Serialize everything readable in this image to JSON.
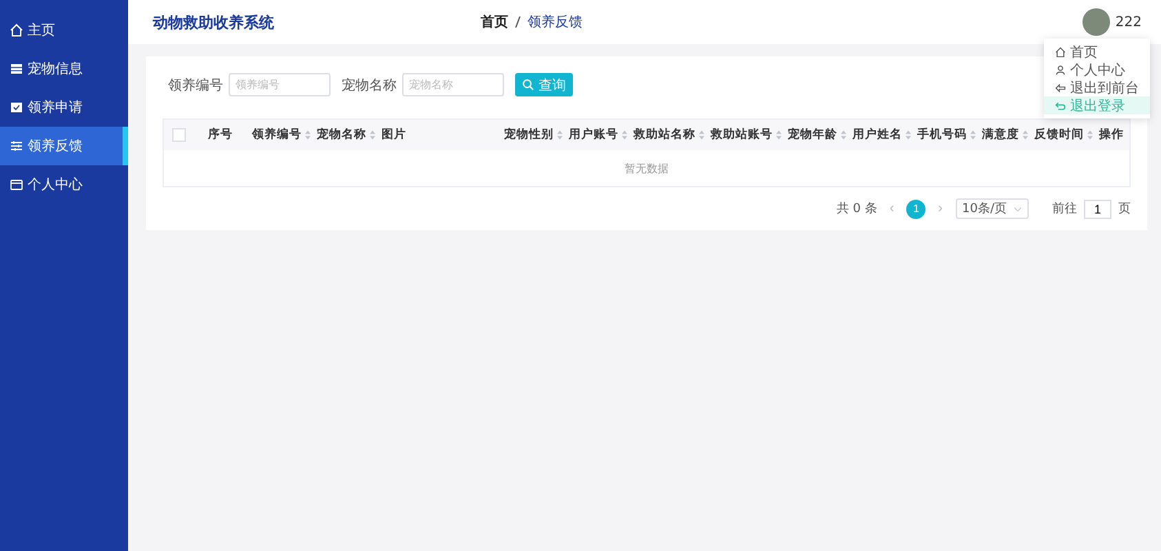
{
  "sidebar": {
    "items": [
      {
        "label": "主页",
        "kind": "home",
        "selected": false
      },
      {
        "label": "宠物信息",
        "kind": "table",
        "selected": false
      },
      {
        "label": "领养申请",
        "kind": "check",
        "selected": false
      },
      {
        "label": "领养反馈",
        "kind": "sliders",
        "selected": true
      },
      {
        "label": "个人中心",
        "kind": "card",
        "selected": false
      }
    ]
  },
  "header": {
    "title": "动物救助收养系统",
    "breadcrumb": [
      "首页",
      "领养反馈"
    ],
    "username": "222"
  },
  "user_menu": {
    "items": [
      {
        "label": "首页",
        "kind": "home",
        "selected": false
      },
      {
        "label": "个人中心",
        "kind": "user",
        "selected": false
      },
      {
        "label": "退出到前台",
        "kind": "arrow",
        "selected": false
      },
      {
        "label": "退出登录",
        "kind": "return",
        "selected": true
      }
    ]
  },
  "search": {
    "fields": [
      {
        "label": "领养编号",
        "placeholder": "领养编号"
      },
      {
        "label": "宠物名称",
        "placeholder": "宠物名称"
      }
    ],
    "button": "查询"
  },
  "table": {
    "columns": [
      {
        "label": "序号",
        "sortable": false
      },
      {
        "label": "领养编号",
        "sortable": true
      },
      {
        "label": "宠物名称",
        "sortable": true
      },
      {
        "label": "图片",
        "sortable": false
      },
      {
        "label": "宠物性别",
        "sortable": true
      },
      {
        "label": "用户账号",
        "sortable": true
      },
      {
        "label": "救助站名称",
        "sortable": true
      },
      {
        "label": "救助站账号",
        "sortable": true
      },
      {
        "label": "宠物年龄",
        "sortable": true
      },
      {
        "label": "用户姓名",
        "sortable": true
      },
      {
        "label": "手机号码",
        "sortable": true
      },
      {
        "label": "满意度",
        "sortable": true
      },
      {
        "label": "反馈时间",
        "sortable": true
      },
      {
        "label": "操作",
        "sortable": false
      }
    ],
    "select_all": {
      "checked": false
    },
    "empty_text": "暂无数据"
  },
  "pagination": {
    "total": "共 0 条",
    "prev": "‹",
    "pages": [
      {
        "label": "1",
        "selected": true
      }
    ],
    "next": "›",
    "page_size": "10条/页",
    "goto_label": "前往",
    "goto_value": "1",
    "goto_suffix": "页"
  }
}
